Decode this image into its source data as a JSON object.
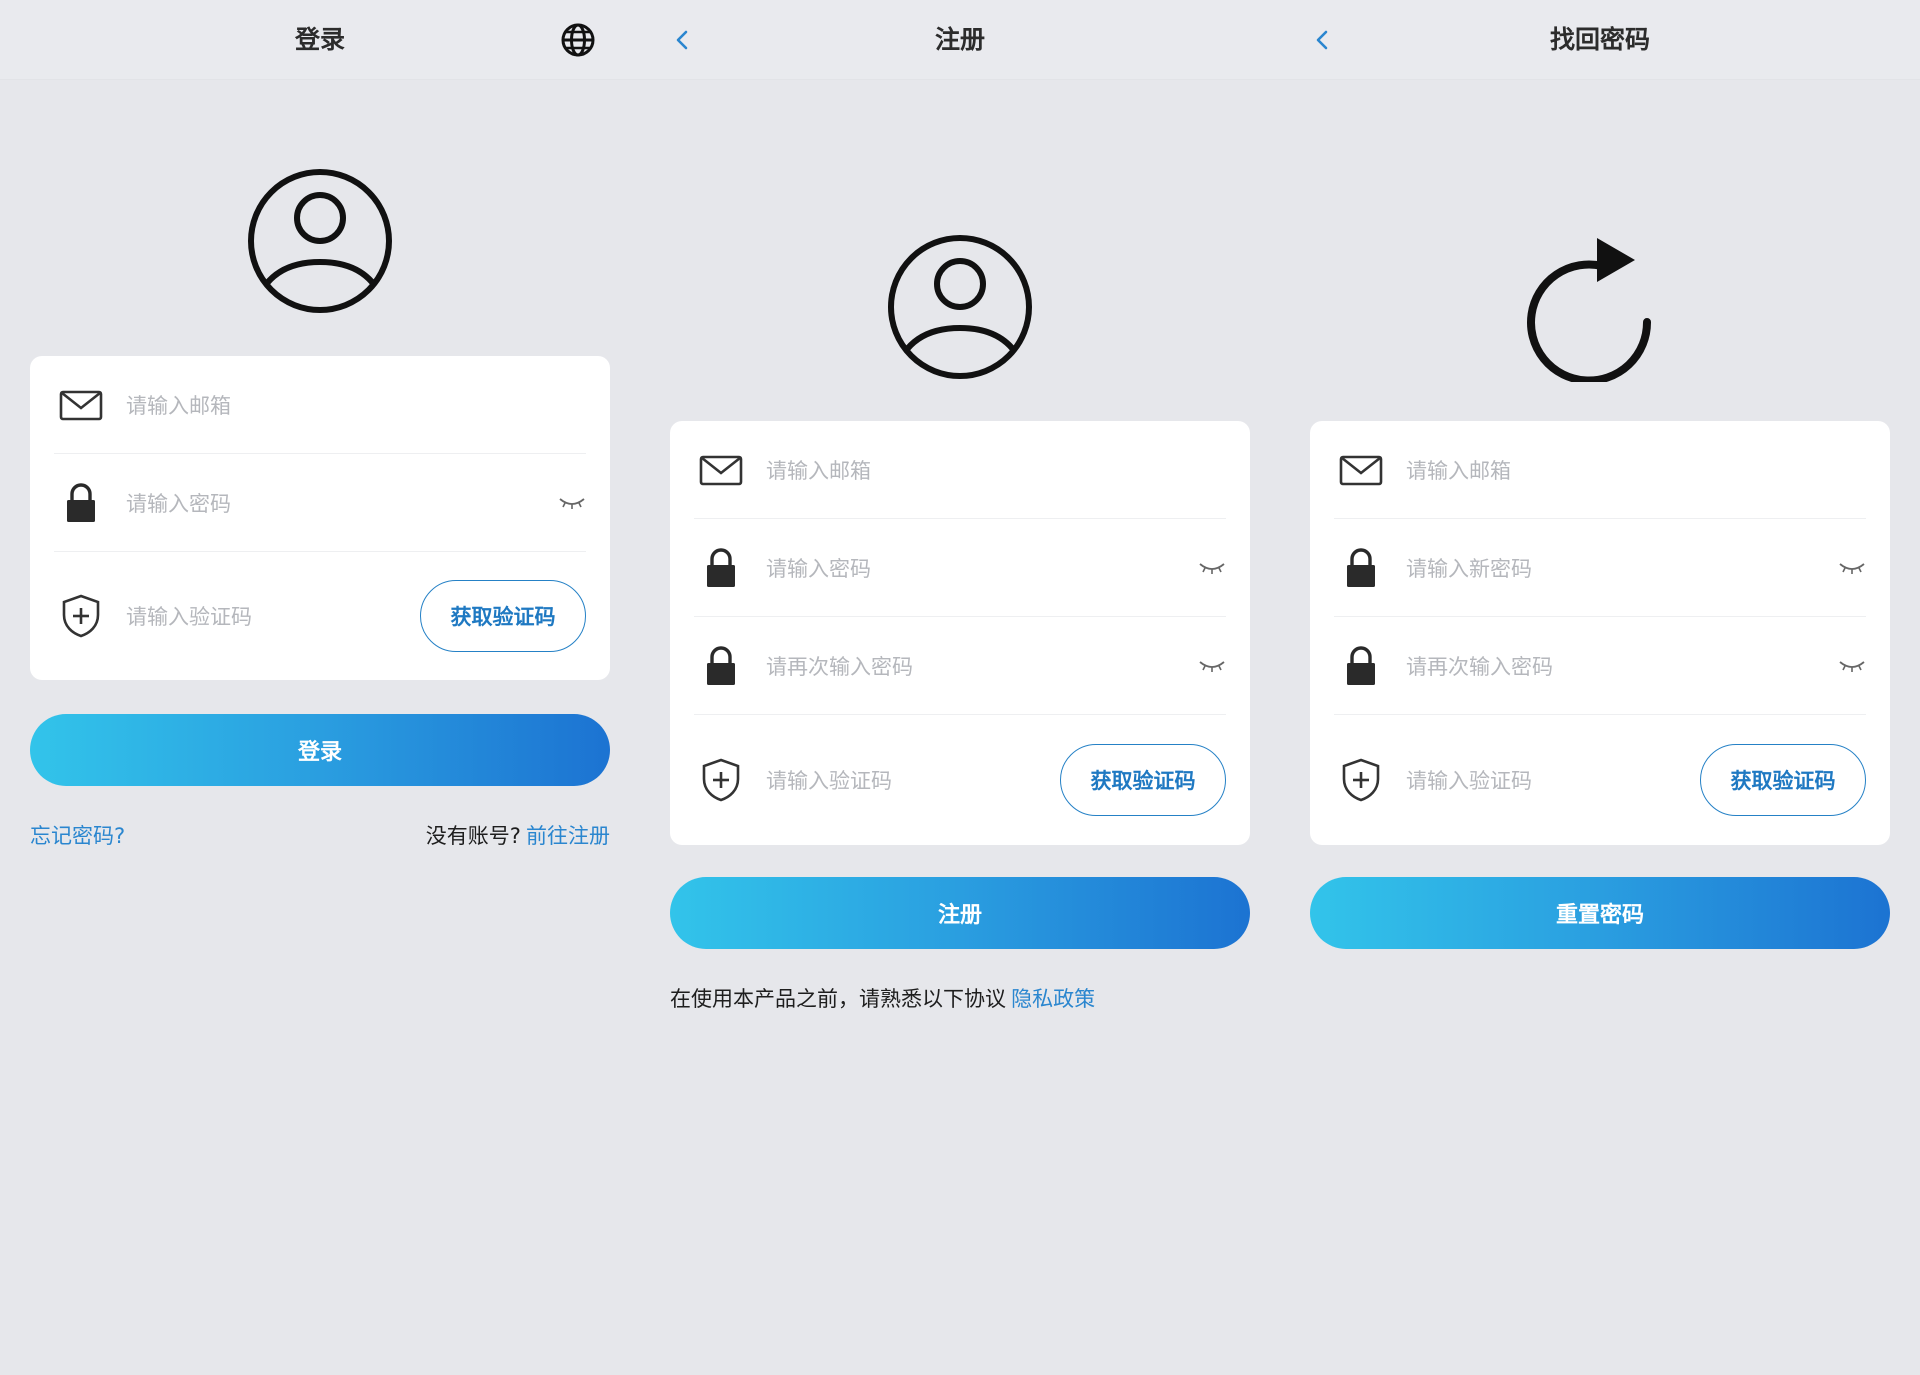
{
  "login": {
    "title": "登录",
    "email_placeholder": "请输入邮箱",
    "password_placeholder": "请输入密码",
    "code_placeholder": "请输入验证码",
    "get_code_label": "获取验证码",
    "submit_label": "登录",
    "forgot_link": "忘记密码?",
    "no_account_text": "没有账号?",
    "register_link": "前往注册",
    "icons": [
      "globe-icon",
      "user-avatar-icon",
      "mail-icon",
      "lock-icon",
      "eye-closed-icon",
      "shield-plus-icon"
    ]
  },
  "register": {
    "title": "注册",
    "email_placeholder": "请输入邮箱",
    "password_placeholder": "请输入密码",
    "confirm_placeholder": "请再次输入密码",
    "code_placeholder": "请输入验证码",
    "get_code_label": "获取验证码",
    "submit_label": "注册",
    "agreement_text": "在使用本产品之前，请熟悉以下协议",
    "privacy_link": "隐私政策",
    "icons": [
      "back-icon",
      "user-avatar-icon",
      "mail-icon",
      "lock-icon",
      "eye-closed-icon",
      "shield-plus-icon"
    ]
  },
  "reset": {
    "title": "找回密码",
    "email_placeholder": "请输入邮箱",
    "new_password_placeholder": "请输入新密码",
    "confirm_placeholder": "请再次输入密码",
    "code_placeholder": "请输入验证码",
    "get_code_label": "获取验证码",
    "submit_label": "重置密码",
    "icons": [
      "back-icon",
      "refresh-icon",
      "mail-icon",
      "lock-icon",
      "eye-closed-icon",
      "shield-plus-icon"
    ]
  },
  "colors": {
    "background": "#e6e7eb",
    "card": "#ffffff",
    "accent": "#1f79c2",
    "link": "#2a86cf",
    "gradient_start": "#32c4ea",
    "gradient_end": "#1c73d2",
    "placeholder": "#b5b7bc"
  }
}
